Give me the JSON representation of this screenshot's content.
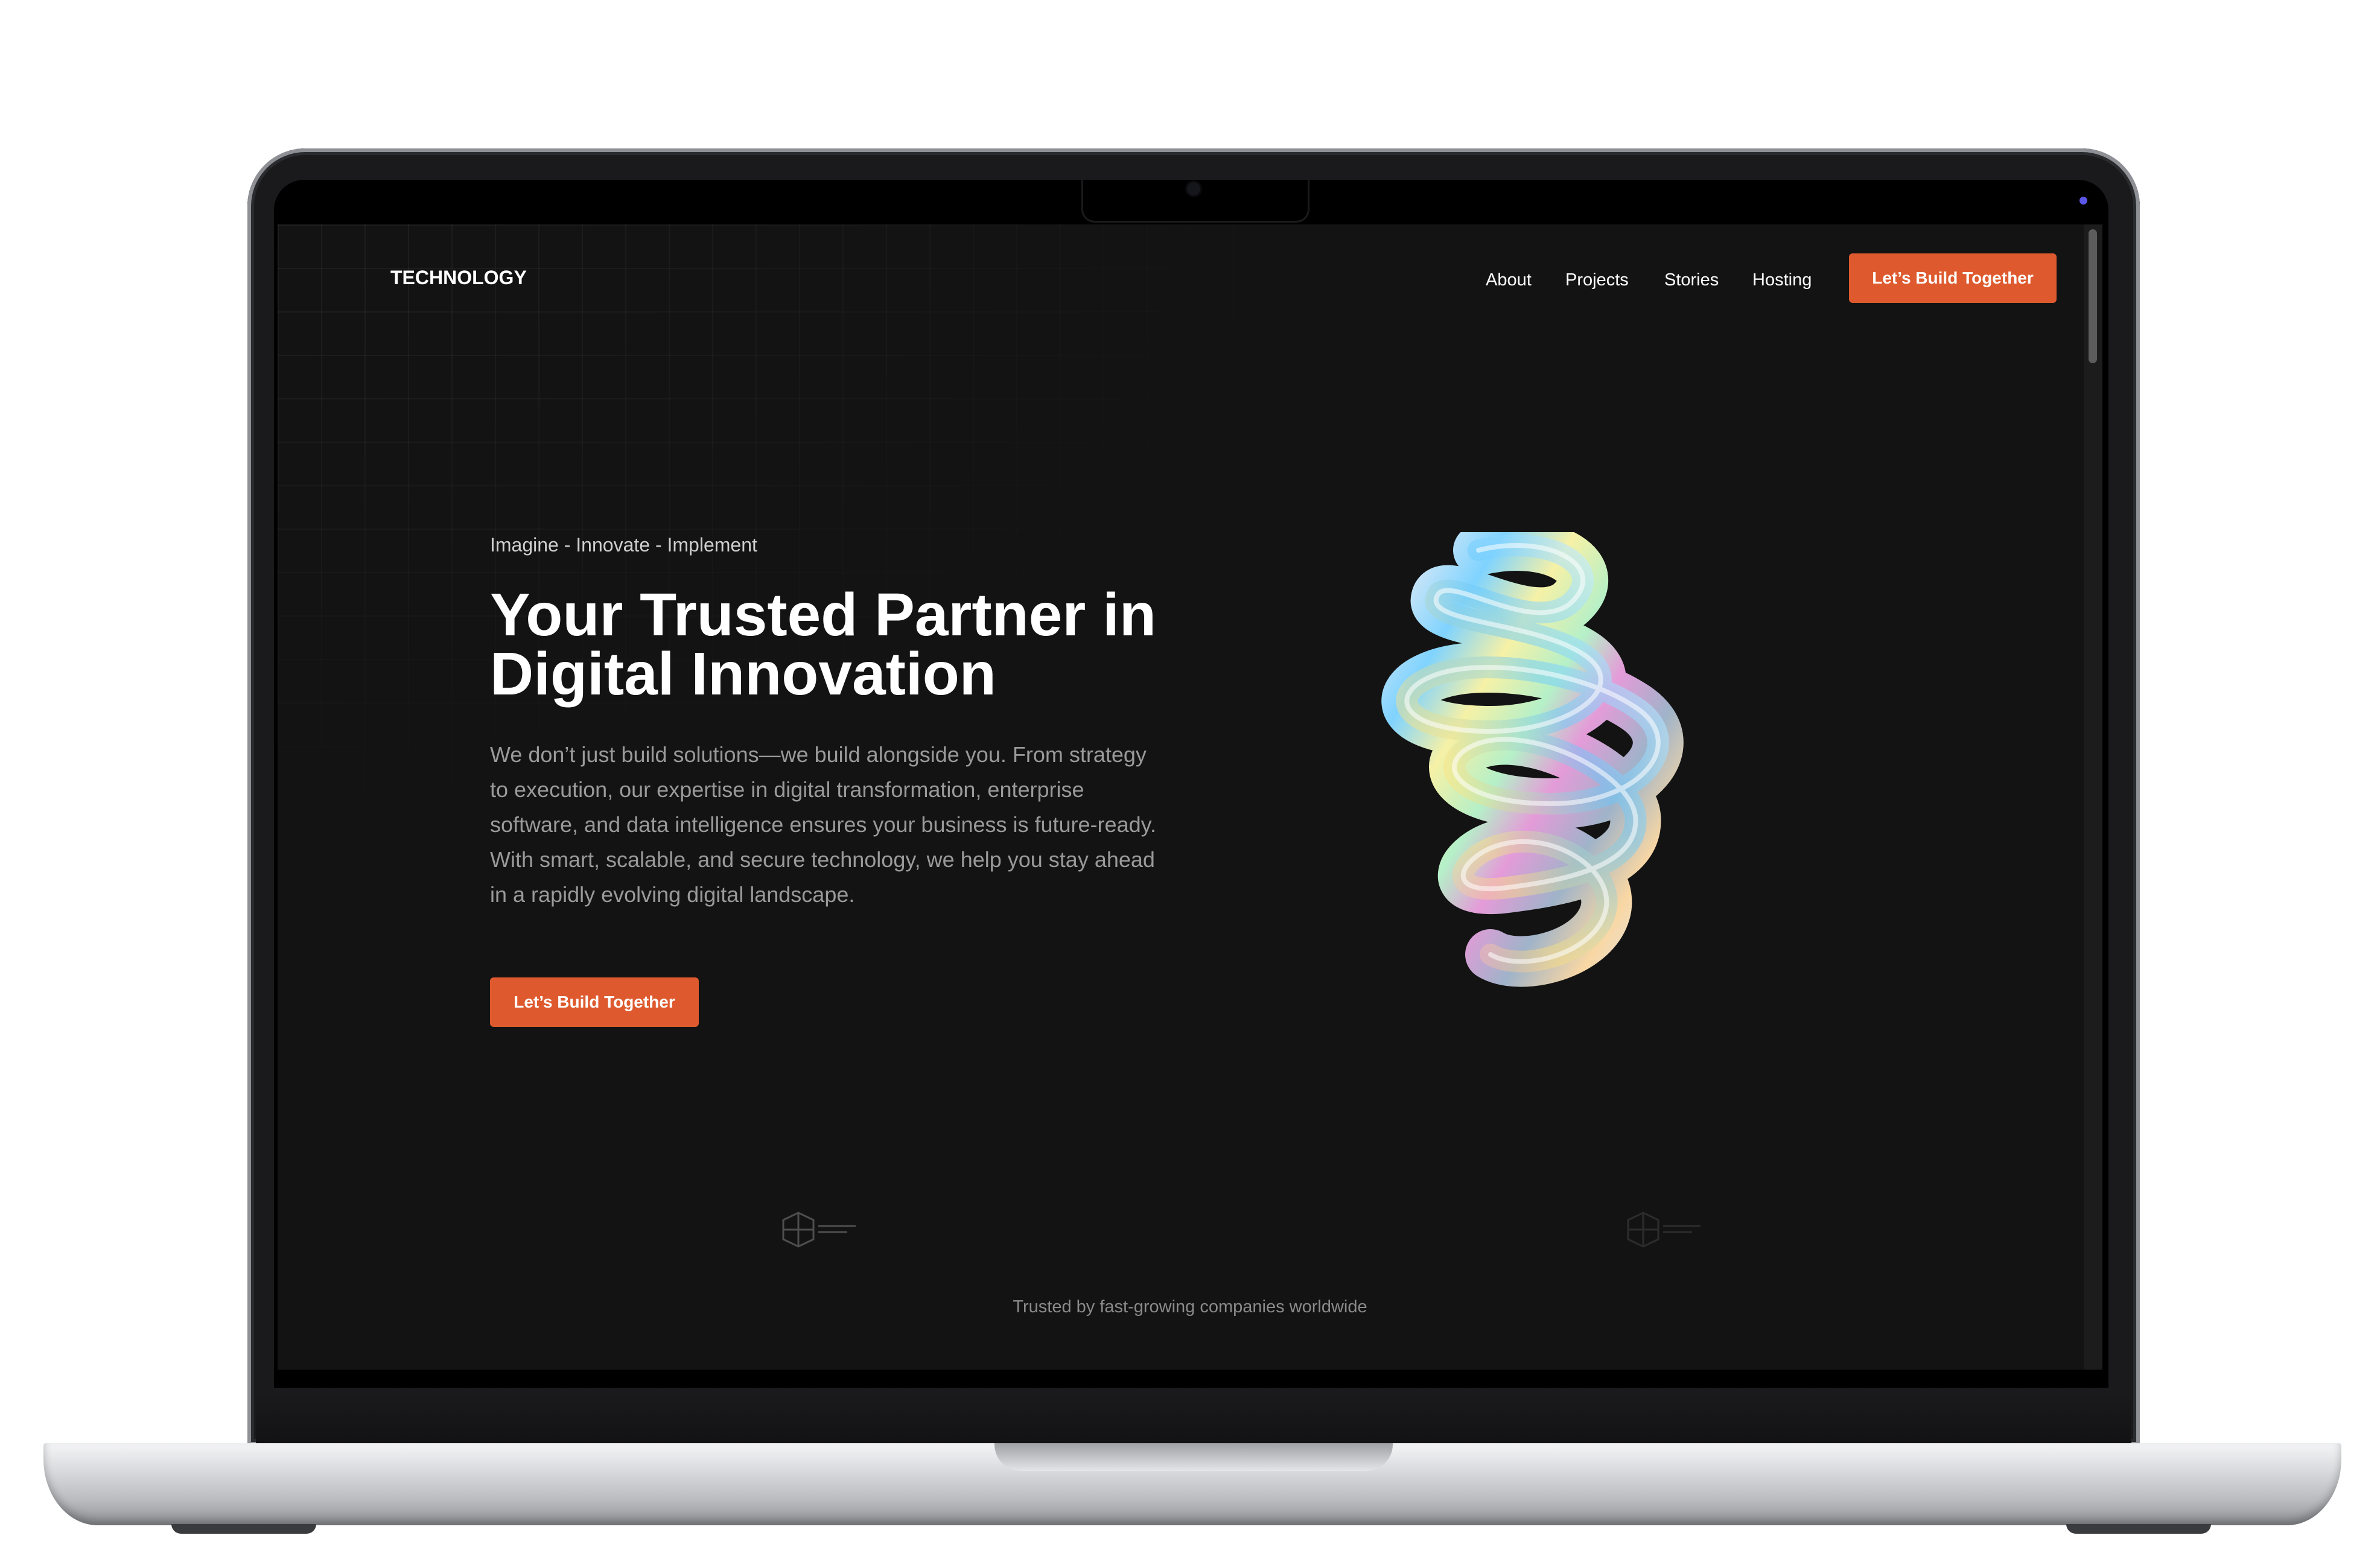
{
  "site": {
    "logo": "TECHNOLOGY",
    "nav": {
      "links": [
        "About",
        "Projects",
        "Stories",
        "Hosting"
      ],
      "cta": "Let’s Build Together"
    },
    "hero": {
      "eyebrow": "Imagine - Innovate - Implement",
      "headline_line1": "Your Trusted Partner in",
      "headline_line2": "Digital Innovation",
      "body": "We don’t just build solutions—we build alongside you. From strategy to execution, our expertise in digital transformation, enterprise software, and data intelligence ensures your business is future-ready. With smart, scalable, and secure technology, we help you stay ahead in a rapidly evolving digital landscape.",
      "cta": "Let’s Build Together"
    },
    "trusted": "Trusted by fast-growing companies worldwide"
  },
  "colors": {
    "accent": "#de5a2e",
    "background": "#131313",
    "text": "#ffffff",
    "muted": "#9a9a9a"
  },
  "icons": {
    "partner_logos": [
      "partner-logo-icon",
      "partner-logo-icon"
    ],
    "hero_art": "iridescent-spiral-3d-art"
  }
}
